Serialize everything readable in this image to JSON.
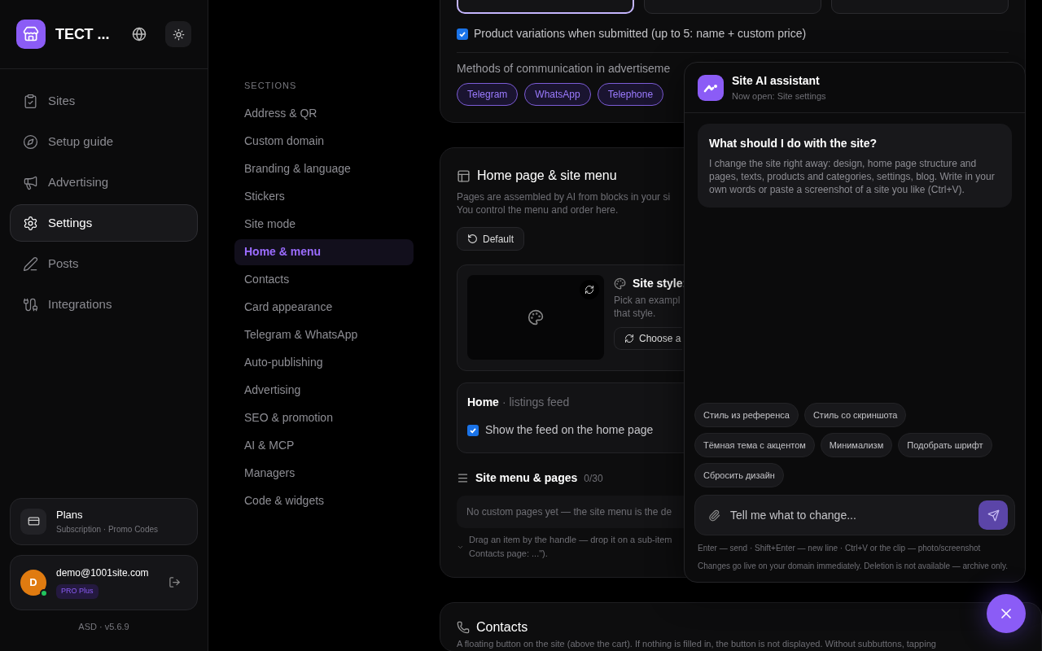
{
  "brand": {
    "title": "ТЕСТ ..."
  },
  "nav": [
    {
      "label": "Sites",
      "selected": false
    },
    {
      "label": "Setup guide",
      "selected": false
    },
    {
      "label": "Advertising",
      "selected": false
    },
    {
      "label": "Settings",
      "selected": true
    },
    {
      "label": "Posts",
      "selected": false
    },
    {
      "label": "Integrations",
      "selected": false
    }
  ],
  "plans": {
    "title": "Plans",
    "subtitle": "Subscription · Promo Codes"
  },
  "account": {
    "initial": "D",
    "email": "demo@1001site.com",
    "plan": "PRO Plus",
    "online": true
  },
  "version": "ASD · v5.6.9",
  "sections": {
    "heading": "SECTIONS",
    "items": [
      {
        "label": "Address & QR",
        "selected": false
      },
      {
        "label": "Custom domain",
        "selected": false
      },
      {
        "label": "Branding & language",
        "selected": false
      },
      {
        "label": "Stickers",
        "selected": false
      },
      {
        "label": "Site mode",
        "selected": false
      },
      {
        "label": "Home & menu",
        "selected": true
      },
      {
        "label": "Contacts",
        "selected": false
      },
      {
        "label": "Card appearance",
        "selected": false
      },
      {
        "label": "Telegram & WhatsApp",
        "selected": false
      },
      {
        "label": "Auto-publishing",
        "selected": false
      },
      {
        "label": "Advertising",
        "selected": false
      },
      {
        "label": "SEO & promotion",
        "selected": false
      },
      {
        "label": "AI & MCP",
        "selected": false
      },
      {
        "label": "Managers",
        "selected": false
      },
      {
        "label": "Code & widgets",
        "selected": false
      }
    ]
  },
  "ads_card": {
    "tiles": [
      {
        "selected": true
      },
      {
        "selected": false
      },
      {
        "selected": false
      }
    ],
    "variations": {
      "label": "Product variations when submitted (up to 5: name + custom price)",
      "checked": true
    },
    "methods_label": "Methods of communication in advertiseme",
    "methods": [
      {
        "label": "Telegram",
        "selected": true
      },
      {
        "label": "WhatsApp",
        "selected": true
      },
      {
        "label": "Telephone",
        "selected": true
      }
    ]
  },
  "home_card": {
    "title": "Home page & site menu",
    "description": "Pages are assembled by AI from blocks in your si\nYou control the menu and order here.",
    "reset_button": "Default",
    "style": {
      "title": "Site style:",
      "description": "Pick an exampl\nthat style.",
      "choose_button": "Choose a"
    },
    "home_feed": {
      "title": "Home",
      "subtitle": "· listings feed",
      "show_feed": {
        "label": "Show the feed on the home page",
        "checked": true
      }
    },
    "menu": {
      "title": "Site menu & pages",
      "count": "0/30",
      "empty": "No custom pages yet — the site menu is the de",
      "hint": "Drag an item by the handle — drop it on a sub-item\nContacts page: ...\")."
    }
  },
  "contacts_card": {
    "title": "Contacts",
    "description": "A floating button on the site (above the cart). If nothing is filled in, the button is not displayed. Without subbuttons, tapping"
  },
  "assistant": {
    "title": "Site AI assistant",
    "subtitle": "Now open: Site settings",
    "message": {
      "title": "What should I do with the site?",
      "body": "I change the site right away: design, home page structure and pages, texts, products and categories, settings, blog. Write in your own words or paste a screenshot of a site you like (Ctrl+V)."
    },
    "suggestions": [
      "Стиль из референса",
      "Стиль со скриншота",
      "Тёмная тема с акцентом",
      "Минимализм",
      "Подобрать шрифт",
      "Сбросить дизайн"
    ],
    "input": {
      "placeholder": "Tell me what to change..."
    },
    "hint": "Enter — send · Shift+Enter — new line · Ctrl+V or the clip — photo/screenshot",
    "notice": "Changes go live on your domain immediately. Deletion is not available — archive only."
  }
}
